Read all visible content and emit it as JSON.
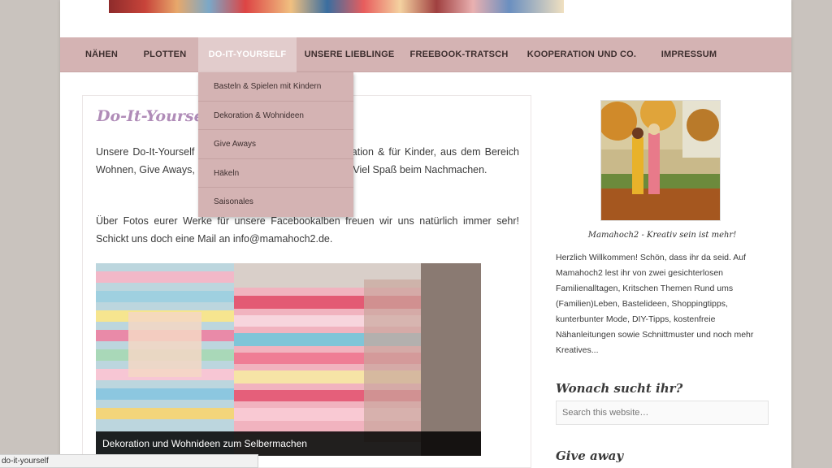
{
  "nav": {
    "items": [
      {
        "label": "NÄHEN"
      },
      {
        "label": "PLOTTEN"
      },
      {
        "label": "DO-IT-YOURSELF"
      },
      {
        "label": "UNSERE LIEBLINGE"
      },
      {
        "label": "FREEBOOK-TRATSCH"
      },
      {
        "label": "KOOPERATION UND CO."
      },
      {
        "label": "IMPRESSUM"
      }
    ],
    "active_index": 2
  },
  "dropdown": {
    "items": [
      {
        "label": "Basteln & Spielen mit Kindern"
      },
      {
        "label": "Dekoration & Wohnideen"
      },
      {
        "label": "Give Aways"
      },
      {
        "label": "Häkeln"
      },
      {
        "label": "Saisonales"
      }
    ]
  },
  "content": {
    "title": "Do-It-Yourself",
    "paragraph1": "Unsere Do-It-Yourself Ideen zu Basteln, Spielen, Dekoration & für Kinder, aus dem Bereich Wohnen, Give Aways, Saisonales und ein wenig Häkeln. Viel Spaß beim Nachmachen.",
    "paragraph2": "Über Fotos eurer Werke für unsere Facebookalben freuen wir uns natürlich immer sehr! Schickt uns doch eine Mail an info@mamahoch2.de.",
    "feature_caption": "Dekoration und Wohnideen zum Selbermachen"
  },
  "sidebar": {
    "profile_caption": "Mamahoch2 - Kreativ sein ist mehr!",
    "welcome_text": "Herzlich Willkommen! Schön, dass ihr da seid. Auf Mamahoch2 lest ihr von zwei gesichterlosen Familienalltagen, Kritschen Themen Rund ums (Familien)Leben, Bastelideen, Shoppingtipps, kunterbunter Mode, DIY-Tipps, kostenfreie Nähanleitungen sowie Schnittmuster und noch mehr Kreatives...",
    "search_title": "Wonach sucht ihr?",
    "search_placeholder": "Search this website…",
    "giveaway_title": "Give away"
  },
  "status_bar": {
    "url": "do-it-yourself"
  },
  "colors": {
    "nav_bg": "#d4b3b3",
    "nav_active_bg": "#e2cccc",
    "title_purple": "#b08cb8"
  }
}
